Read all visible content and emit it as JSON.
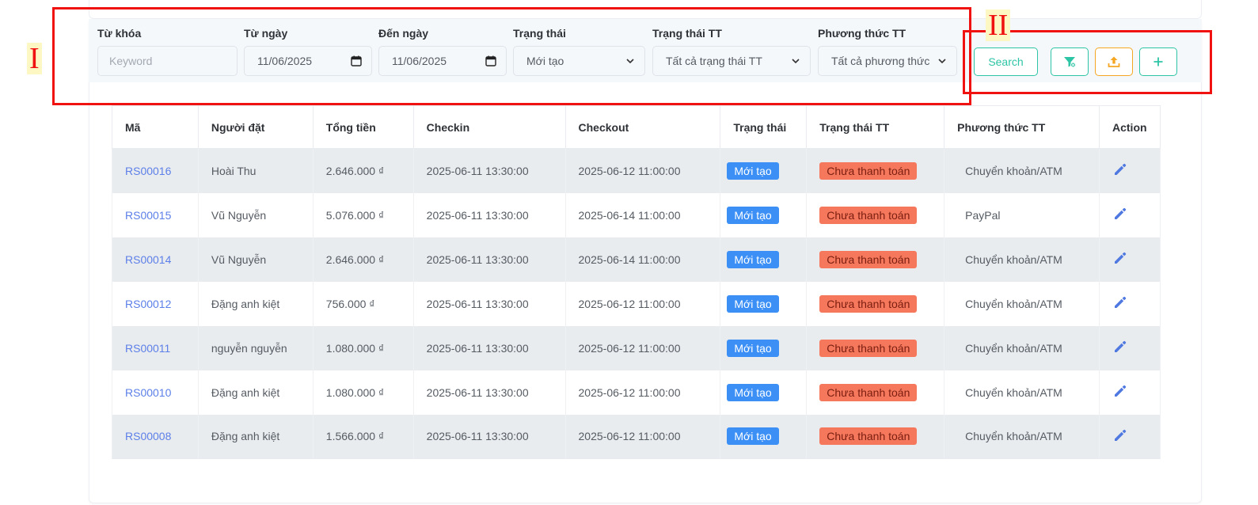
{
  "filters": {
    "keyword": {
      "label": "Từ khóa",
      "placeholder": "Keyword",
      "value": ""
    },
    "from_date": {
      "label": "Từ ngày",
      "value": "11/06/2025"
    },
    "to_date": {
      "label": "Đến ngày",
      "value": "11/06/2025"
    },
    "status": {
      "label": "Trạng thái",
      "value": "Mới tạo"
    },
    "payment_status": {
      "label": "Trạng thái TT",
      "value": "Tất cả trạng thái TT"
    },
    "payment_method": {
      "label": "Phương thức TT",
      "value": "Tất cả phương thức TT"
    }
  },
  "actions": {
    "search_label": "Search",
    "filter_icon": "filter-icon",
    "export_icon": "upload-icon",
    "add_icon": "plus-icon",
    "accent_color": "#2ec4a6",
    "export_color": "#f5a623"
  },
  "annotations": [
    {
      "label": "I",
      "color": "#f01111"
    },
    {
      "label": "II",
      "color": "#f01111"
    }
  ],
  "table": {
    "columns": [
      "Mã",
      "Người đặt",
      "Tổng tiền",
      "Checkin",
      "Checkout",
      "Trạng thái",
      "Trạng thái TT",
      "Phương thức TT",
      "Action"
    ],
    "rows": [
      {
        "code": "RS00016",
        "customer": "Hoài Thu",
        "total": "2.646.000 ₫",
        "checkin": "2025-06-11 13:30:00",
        "checkout": "2025-06-12 11:00:00",
        "status": "Mới tạo",
        "payment_status": "Chưa thanh toán",
        "method": "Chuyển khoản/ATM"
      },
      {
        "code": "RS00015",
        "customer": "Vũ Nguyễn",
        "total": "5.076.000 ₫",
        "checkin": "2025-06-11 13:30:00",
        "checkout": "2025-06-14 11:00:00",
        "status": "Mới tạo",
        "payment_status": "Chưa thanh toán",
        "method": "PayPal"
      },
      {
        "code": "RS00014",
        "customer": "Vũ Nguyễn",
        "total": "2.646.000 ₫",
        "checkin": "2025-06-11 13:30:00",
        "checkout": "2025-06-14 11:00:00",
        "status": "Mới tạo",
        "payment_status": "Chưa thanh toán",
        "method": "Chuyển khoản/ATM"
      },
      {
        "code": "RS00012",
        "customer": "Đặng anh kiệt",
        "total": "756.000 ₫",
        "checkin": "2025-06-11 13:30:00",
        "checkout": "2025-06-12 11:00:00",
        "status": "Mới tạo",
        "payment_status": "Chưa thanh toán",
        "method": "Chuyển khoản/ATM"
      },
      {
        "code": "RS00011",
        "customer": "nguyễn nguyễn",
        "total": "1.080.000 ₫",
        "checkin": "2025-06-11 13:30:00",
        "checkout": "2025-06-12 11:00:00",
        "status": "Mới tạo",
        "payment_status": "Chưa thanh toán",
        "method": "Chuyển khoản/ATM"
      },
      {
        "code": "RS00010",
        "customer": "Đặng anh kiệt",
        "total": "1.080.000 ₫",
        "checkin": "2025-06-11 13:30:00",
        "checkout": "2025-06-12 11:00:00",
        "status": "Mới tạo",
        "payment_status": "Chưa thanh toán",
        "method": "Chuyển khoản/ATM"
      },
      {
        "code": "RS00008",
        "customer": "Đặng anh kiệt",
        "total": "1.566.000 ₫",
        "checkin": "2025-06-11 13:30:00",
        "checkout": "2025-06-12 11:00:00",
        "status": "Mới tạo",
        "payment_status": "Chưa thanh toán",
        "method": "Chuyển khoản/ATM"
      }
    ],
    "row_action_icon": "pencil-icon",
    "status_color": "#3b8ff5",
    "payment_status_color": "#f5785c",
    "link_color": "#5c7fe8"
  }
}
